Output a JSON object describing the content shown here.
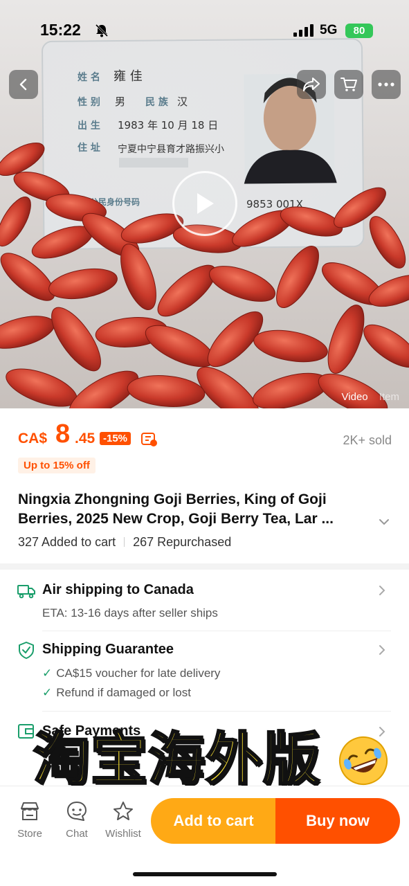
{
  "status_bar": {
    "time": "15:22",
    "network": "5G",
    "battery": "80"
  },
  "hero": {
    "media_tabs": [
      "Video",
      "Item"
    ],
    "id_card": {
      "name_label": "姓 名",
      "name_value": "雍 佳",
      "sex_label": "性 别",
      "sex_value": "男",
      "ethnic_label": "民 族",
      "ethnic_value": "汉",
      "birth_label": "出 生",
      "birth_value": "1983 年 10 月 18 日",
      "address_label": "住 址",
      "address_value": "宁夏中宁县育才路振兴小",
      "id_label": "公民身份号码",
      "id_value": "9853 001X"
    }
  },
  "price": {
    "currency": "CA$",
    "integer": "8",
    "decimal": ".45",
    "discount": "-15%",
    "sold": "2K+ sold",
    "promo": "Up to 15% off"
  },
  "product": {
    "title": "Ningxia Zhongning Goji Berries, King of Goji Berries, 2025 New Crop, Goji Berry Tea, Lar ...",
    "added_to_cart": "327 Added to cart",
    "repurchased": "267 Repurchased"
  },
  "services": {
    "shipping_title": "Air shipping to Canada",
    "eta_label": "ETA:",
    "eta_value": "13-16 days after seller ships",
    "guarantee_title": "Shipping Guarantee",
    "guarantee_items": [
      "CA$15 voucher for late delivery",
      "Refund if damaged or lost"
    ],
    "payments_title": "Safe Payments"
  },
  "overlay_caption": "淘宝海外版",
  "bottom_bar": {
    "store": "Store",
    "chat": "Chat",
    "wishlist": "Wishlist",
    "add_to_cart": "Add to cart",
    "buy_now": "Buy now"
  },
  "colors": {
    "accent": "#ff5000",
    "add_to_cart": "#ffa915",
    "check": "#1a9e6b",
    "caption": "#ffe633"
  }
}
